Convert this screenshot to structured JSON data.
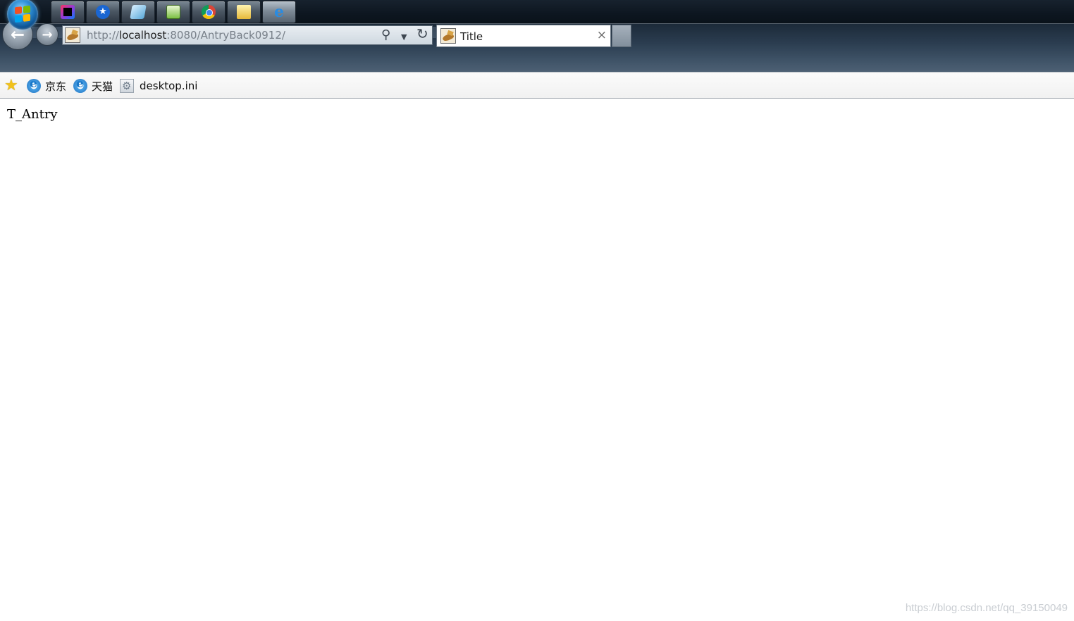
{
  "browser": {
    "address": {
      "url_scheme": "http://",
      "url_host": "localhost",
      "url_rest": ":8080/AntryBack0912/"
    },
    "tab": {
      "title": "Title",
      "close_icon": "×"
    }
  },
  "favorites": {
    "items": [
      {
        "label": "京东",
        "icon": "ie-icon"
      },
      {
        "label": "天猫",
        "icon": "ie-icon"
      },
      {
        "label": "desktop.ini",
        "icon": "settings-file-icon"
      }
    ]
  },
  "page": {
    "content_text": "T_Antry"
  },
  "watermark": "https://blog.csdn.net/qq_39150049"
}
